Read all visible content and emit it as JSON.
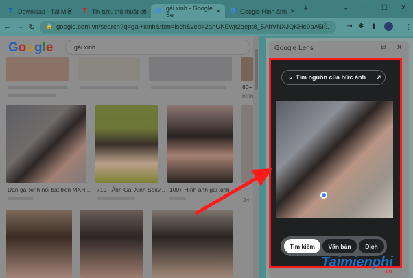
{
  "tabs": [
    {
      "label": "Download - Tải Miễ",
      "icon": "T"
    },
    {
      "label": "Tin tức, thủ thuật cô",
      "icon": "T"
    },
    {
      "label": "gái xinh - Google Se",
      "icon": "G",
      "active": true
    },
    {
      "label": "Google Hình ảnh",
      "icon": "G"
    }
  ],
  "address": {
    "url": "google.com.vn/search?q=gái+xinh&tbm=isch&ved=2ahUKEwjt2qept8_5AhVNXJQKHe0aA5I..."
  },
  "google": {
    "logo": "Google",
    "query": "gái xinh"
  },
  "results": [
    {
      "caption": "Dàn gái xinh nổi bật trên MXH ..."
    },
    {
      "caption": "719+ Ảnh Gái Xinh Sexy..."
    },
    {
      "caption": "100+ Hình ảnh gái xinh ..."
    },
    {
      "caption": "80+"
    },
    {
      "caption": "hình"
    },
    {
      "caption": "24h."
    }
  ],
  "lens": {
    "title": "Google Lens",
    "source_button": "Tìm nguồn của bức ảnh",
    "modes": [
      "Tìm kiếm",
      "Văn bản",
      "Dịch"
    ]
  },
  "watermark": {
    "text": "Taimienphi",
    ".vn": ".vn"
  },
  "colors": {
    "highlight": "#ff1a1a",
    "accent": "#4285f4"
  }
}
